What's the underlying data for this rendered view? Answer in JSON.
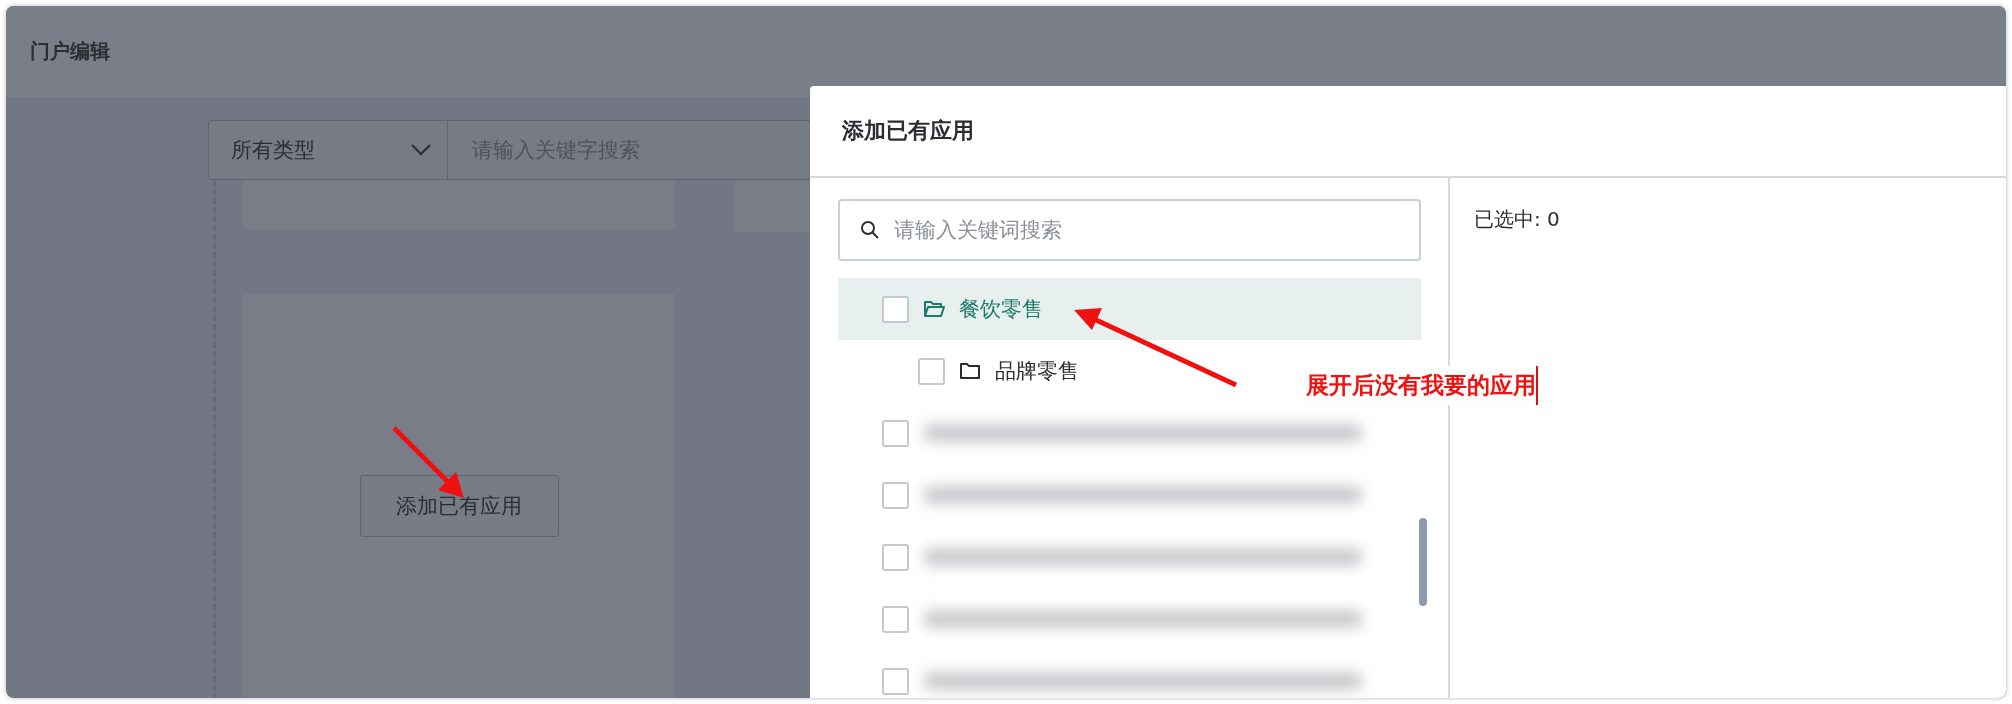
{
  "window": {
    "title": "门户编辑"
  },
  "background": {
    "type_select": {
      "value": "所有类型"
    },
    "search": {
      "placeholder": "请输入关键字搜索"
    },
    "add_button": "添加已有应用"
  },
  "dialog": {
    "title": "添加已有应用",
    "search": {
      "placeholder": "请输入关键词搜索"
    },
    "tree": [
      {
        "kind": "folder",
        "label": "餐饮零售",
        "checked": false,
        "selected": true,
        "expanded": true,
        "children": [
          {
            "kind": "folder",
            "label": "品牌零售",
            "checked": false,
            "selected": false,
            "expanded": false
          }
        ]
      },
      {
        "kind": "redacted",
        "checked": false,
        "selected": false
      },
      {
        "kind": "redacted",
        "checked": false,
        "selected": false
      },
      {
        "kind": "redacted",
        "checked": false,
        "selected": false
      },
      {
        "kind": "redacted",
        "checked": false,
        "selected": false
      },
      {
        "kind": "redacted",
        "checked": false,
        "selected": false
      }
    ],
    "selected_count": "已选中: 0"
  },
  "annotations": [
    {
      "text": "展开后没有我要的应用"
    }
  ]
}
